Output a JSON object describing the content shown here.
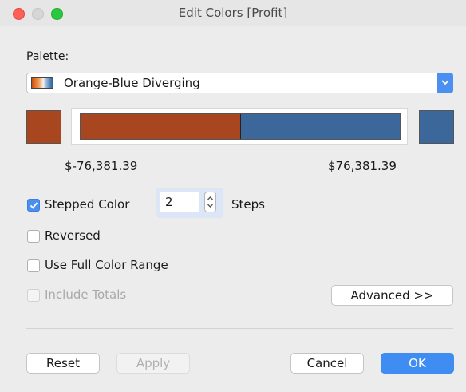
{
  "window": {
    "title": "Edit Colors [Profit]"
  },
  "palette": {
    "label": "Palette:",
    "selected": "Orange-Blue Diverging"
  },
  "range": {
    "min_label": "$-76,381.39",
    "max_label": "$76,381.39"
  },
  "options": {
    "stepped_color": {
      "label": "Stepped Color",
      "checked": true
    },
    "steps_value": "2",
    "steps_label": "Steps",
    "reversed": {
      "label": "Reversed",
      "checked": false
    },
    "full_range": {
      "label": "Use Full Color Range",
      "checked": false
    },
    "include_totals": {
      "label": "Include Totals",
      "checked": false,
      "enabled": false
    }
  },
  "buttons": {
    "advanced": "Advanced >>",
    "reset": "Reset",
    "apply": "Apply",
    "cancel": "Cancel",
    "ok": "OK"
  },
  "colors": {
    "orange": "#a8461f",
    "blue": "#3c679a",
    "accent": "#3f8cf2"
  }
}
